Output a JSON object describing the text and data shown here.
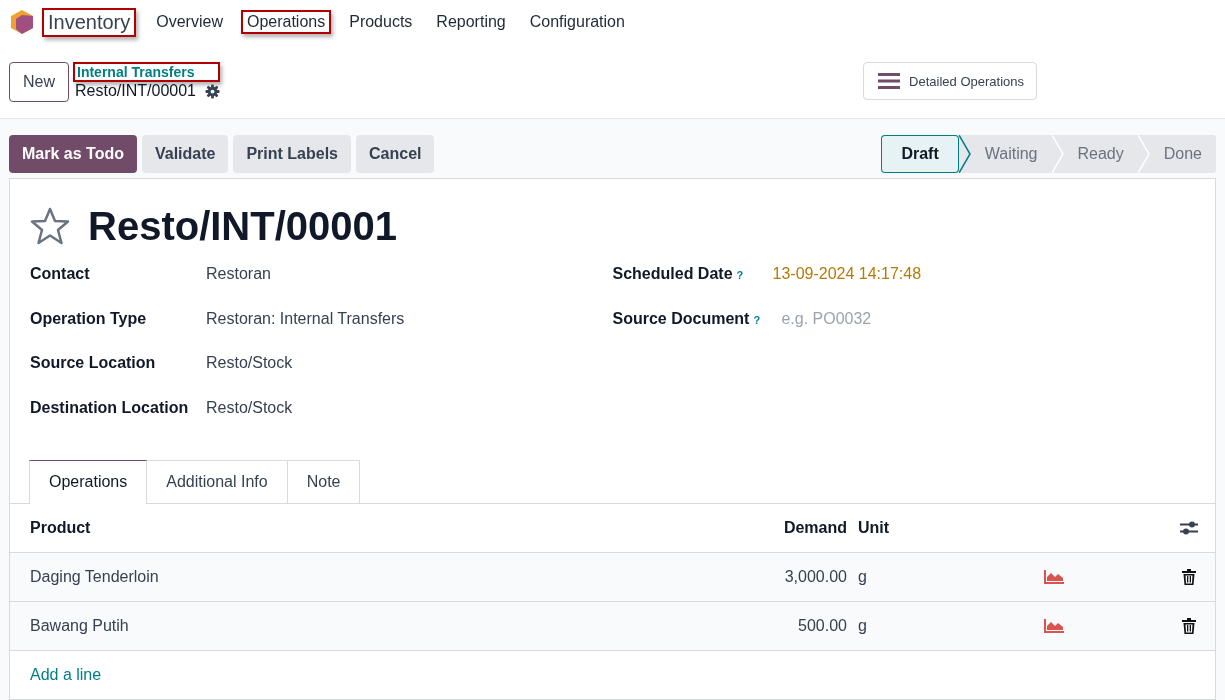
{
  "app": {
    "name": "Inventory",
    "highlighted": true
  },
  "menu": [
    {
      "label": "Overview",
      "highlighted": false
    },
    {
      "label": "Operations",
      "highlighted": true
    },
    {
      "label": "Products",
      "highlighted": false
    },
    {
      "label": "Reporting",
      "highlighted": false
    },
    {
      "label": "Configuration",
      "highlighted": false
    }
  ],
  "new_button": "New",
  "breadcrumb": {
    "parent": "Internal Transfers",
    "parent_highlighted": true,
    "current": "Resto/INT/00001"
  },
  "view_button": "Detailed Operations",
  "actions": [
    {
      "label": "Mark as Todo",
      "kind": "primary"
    },
    {
      "label": "Validate",
      "kind": "secondary"
    },
    {
      "label": "Print Labels",
      "kind": "secondary"
    },
    {
      "label": "Cancel",
      "kind": "secondary"
    }
  ],
  "statusbar": [
    {
      "label": "Draft",
      "selected": true
    },
    {
      "label": "Waiting",
      "selected": false
    },
    {
      "label": "Ready",
      "selected": false
    },
    {
      "label": "Done",
      "selected": false
    }
  ],
  "record": {
    "title": "Resto/INT/00001",
    "starred": false
  },
  "fields_left": [
    {
      "label": "Contact",
      "value": "Restoran"
    },
    {
      "label": "Operation Type",
      "value": "Restoran: Internal Transfers"
    },
    {
      "label": "Source Location",
      "value": "Resto/Stock"
    },
    {
      "label": "Destination Location",
      "value": "Resto/Stock"
    }
  ],
  "fields_right": [
    {
      "label": "Scheduled Date",
      "help": "?",
      "kind": "date",
      "value": "13-09-2024 14:17:48"
    },
    {
      "label": "Source Document",
      "help": "?",
      "kind": "input",
      "placeholder": "e.g. PO0032"
    }
  ],
  "tabs": [
    {
      "label": "Operations",
      "selected": true
    },
    {
      "label": "Additional Info",
      "selected": false
    },
    {
      "label": "Note",
      "selected": false
    }
  ],
  "table": {
    "columns": [
      "Product",
      "Demand",
      "Unit"
    ],
    "rows": [
      {
        "product": "Daging Tenderloin",
        "demand": "3,000.00",
        "unit": "g"
      },
      {
        "product": "Bawang Putih",
        "demand": "500.00",
        "unit": "g"
      }
    ],
    "add_line": "Add a line"
  }
}
